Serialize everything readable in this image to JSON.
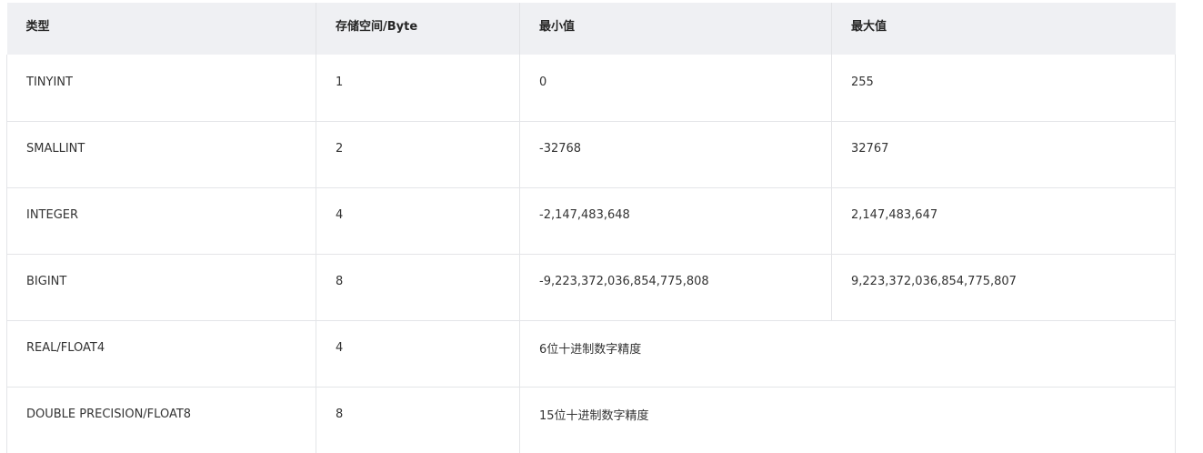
{
  "table": {
    "headers": [
      "类型",
      "存储空间/Byte",
      "最小值",
      "最大值"
    ],
    "rows": [
      {
        "type": "TINYINT",
        "storage": "1",
        "min": "0",
        "max": "255"
      },
      {
        "type": "SMALLINT",
        "storage": "2",
        "min": "-32768",
        "max": "32767"
      },
      {
        "type": "INTEGER",
        "storage": "4",
        "min": "-2,147,483,648",
        "max": "2,147,483,647"
      },
      {
        "type": "BIGINT",
        "storage": "8",
        "min": "-9,223,372,036,854,775,808",
        "max": "9,223,372,036,854,775,807"
      },
      {
        "type": "REAL/FLOAT4",
        "storage": "4",
        "precision": "6位十进制数字精度"
      },
      {
        "type": "DOUBLE PRECISION/FLOAT8",
        "storage": "8",
        "precision": "15位十进制数字精度"
      }
    ]
  }
}
